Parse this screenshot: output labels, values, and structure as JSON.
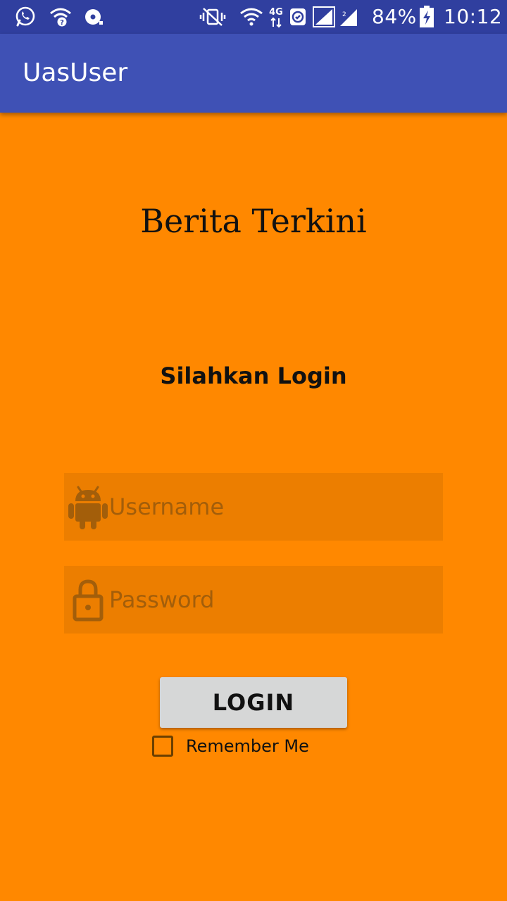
{
  "status_bar": {
    "battery_percent": "84%",
    "time": "10:12",
    "network_label": "4G",
    "icons": [
      "whatsapp-icon",
      "wifi-question-icon",
      "sync-disc-icon",
      "vibrate-off-icon",
      "wifi-icon",
      "network-4g-icon",
      "data-saver-icon",
      "signal-sim1-icon",
      "signal-sim2-icon",
      "battery-charging-icon"
    ]
  },
  "app_bar": {
    "title": "UasUser"
  },
  "main": {
    "headline": "Berita Terkini",
    "subtitle": "Silahkan Login",
    "username_placeholder": "Username",
    "username_value": "",
    "password_placeholder": "Password",
    "password_value": "",
    "login_label": "LOGIN",
    "remember_label": "Remember Me",
    "remember_checked": false
  },
  "colors": {
    "status_bar": "#303F9F",
    "app_bar": "#3F51B5",
    "background": "#FF8800",
    "field_background": "#EF7D00",
    "button": "#D6D7D7"
  }
}
